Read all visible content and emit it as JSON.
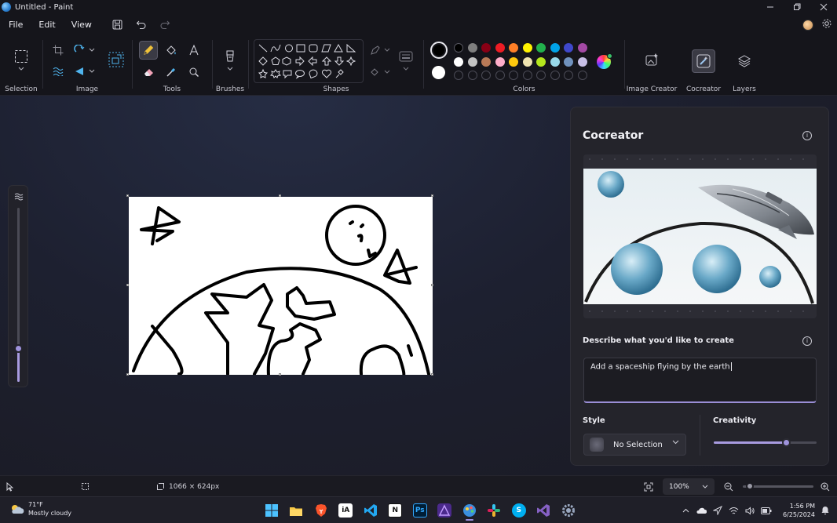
{
  "window": {
    "title": "Untitled - Paint",
    "controls": [
      "minimize",
      "maximize",
      "close"
    ]
  },
  "menu": {
    "items": [
      "File",
      "Edit",
      "View"
    ],
    "quick_actions": [
      "save-icon",
      "undo-icon",
      "redo-icon"
    ]
  },
  "ribbon": {
    "groups": {
      "selection": "Selection",
      "image": "Image",
      "tools": "Tools",
      "brushes": "Brushes",
      "shapes": "Shapes",
      "colors": "Colors",
      "image_creator": "Image Creator",
      "cocreator": "Cocreator",
      "layers": "Layers"
    },
    "colors": {
      "primary": "#000000",
      "secondary": "#ffffff",
      "palette_row1": [
        "#000000",
        "#7f7f7f",
        "#880015",
        "#ed1c24",
        "#ff7f27",
        "#fff200",
        "#22b14c",
        "#00a2e8",
        "#3f48cc",
        "#a349a4"
      ],
      "palette_row2": [
        "#ffffff",
        "#c3c3c3",
        "#b97a57",
        "#ffaec9",
        "#ffc90e",
        "#efe4b0",
        "#b5e61d",
        "#99d9ea",
        "#7092be",
        "#c8bfe7"
      ]
    }
  },
  "cocreator": {
    "title": "Cocreator",
    "prompt_label": "Describe what you'd like to create",
    "prompt_value": "Add a spaceship flying by the earth",
    "style_label": "Style",
    "style_value": "No Selection",
    "creativity_label": "Creativity",
    "creativity_level": 0.7,
    "accent": "#a89be0"
  },
  "statusbar": {
    "canvas_size": "1066 × 624px",
    "zoom": "100%",
    "zoom_level": 0.1
  },
  "taskbar": {
    "weather_temp": "71°F",
    "weather_desc": "Mostly cloudy",
    "time": "1:56 PM",
    "date": "6/25/2024",
    "apps": [
      {
        "name": "start",
        "label": "",
        "color": "#4cc2ff"
      },
      {
        "name": "file-explorer",
        "label": "",
        "color": "#f7c846"
      },
      {
        "name": "brave",
        "label": "",
        "color": "#fb542b"
      },
      {
        "name": "ia-writer",
        "label": "iA",
        "color": "#ffffff"
      },
      {
        "name": "vscode",
        "label": "",
        "color": "#23a8f2"
      },
      {
        "name": "notion",
        "label": "N",
        "color": "#ffffff"
      },
      {
        "name": "photoshop",
        "label": "Ps",
        "color": "#001e36"
      },
      {
        "name": "affinity",
        "label": "",
        "color": "#7e4dd2"
      },
      {
        "name": "paint",
        "label": "",
        "color": "#3a8fe0"
      },
      {
        "name": "slack",
        "label": "",
        "color": "#e8e8e8"
      },
      {
        "name": "skype",
        "label": "S",
        "color": "#00aff0"
      },
      {
        "name": "visual-studio",
        "label": "",
        "color": "#8661c5"
      },
      {
        "name": "settings",
        "label": "",
        "color": "#9aa8c0"
      }
    ]
  }
}
